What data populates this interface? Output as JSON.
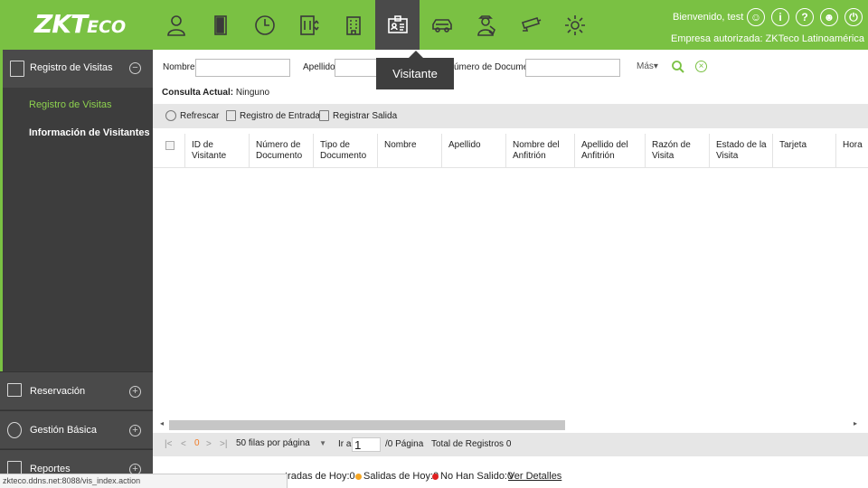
{
  "brand": {
    "logo_main": "ZKT",
    "logo_small": "ECO"
  },
  "header": {
    "welcome": "Bienvenido, test",
    "company": "Empresa autorizada: ZKTeco Latinoamérica",
    "nav_icons": [
      "person-icon",
      "door-icon",
      "clock-icon",
      "elevator-icon",
      "building-icon",
      "visitor-badge-icon",
      "car-icon",
      "guard-icon",
      "camera-icon",
      "gear-icon"
    ],
    "active_nav": "Visitante",
    "actions": [
      {
        "name": "user-circle-icon",
        "glyph": "☺"
      },
      {
        "name": "info-icon",
        "glyph": "i"
      },
      {
        "name": "help-icon",
        "glyph": "?"
      },
      {
        "name": "account-icon",
        "glyph": "☻"
      },
      {
        "name": "power-icon",
        "glyph": "⏻"
      }
    ]
  },
  "sidebar": {
    "section_main": "Registro de Visitas",
    "subitems": [
      "Registro de Visitas",
      "Información de Visitantes"
    ],
    "sections": [
      "Reservación",
      "Gestión Básica",
      "Reportes"
    ]
  },
  "filters": {
    "nombre_label": "Nombre",
    "apellido_label": "Apellido",
    "documento_label": "úmero de Documento",
    "more_label": "Más▾"
  },
  "query": {
    "label": "Consulta Actual:",
    "value": "Ninguno"
  },
  "toolbar": {
    "refresh": "Refrescar",
    "entry": "Registro de Entrada",
    "exit": "Registrar Salida"
  },
  "table": {
    "columns": [
      "ID de Visitante",
      "Número de Documento",
      "Tipo de Documento",
      "Nombre",
      "Apellido",
      "Nombre del Anfitrión",
      "Apellido del Anfitrión",
      "Razón de Visita",
      "Estado de la Visita",
      "Tarjeta",
      "Hora"
    ],
    "rows": []
  },
  "pager": {
    "page": "0",
    "rows_per_page": "50 filas por página",
    "goto_label": "Ir a",
    "goto_value": "1",
    "pages": "/0 Página",
    "total": "Total de Registros 0"
  },
  "status": {
    "entries": "tradas de Hoy:0",
    "exits": "Salidas de Hoy:0",
    "not_exited": "No Han Salido:0",
    "details": "Ver Detalles",
    "colors": {
      "exits": "#f5a623",
      "not_exited": "#e02020"
    }
  },
  "url_status": "zkteco.ddns.net:8088/vis_index.action",
  "colors": {
    "accent": "#7ac143",
    "sidebar": "#3d3d3d",
    "active_sub": "#8dd14f"
  }
}
